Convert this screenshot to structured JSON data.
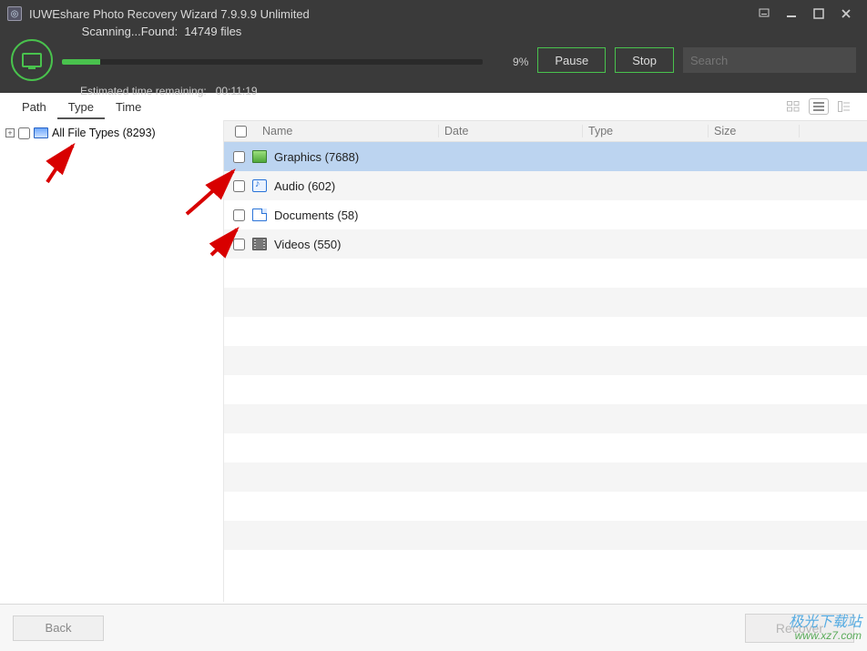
{
  "title_bar": {
    "app_title": "IUWEshare Photo Recovery Wizard 7.9.9.9 Unlimited"
  },
  "progress": {
    "line1_prefix": "Scanning...Found:  ",
    "found_count": "14749",
    "line1_suffix": " files",
    "percent_text": "9%",
    "percent_value": 9,
    "line2_prefix": "Estimated time remaining:   ",
    "eta": "00:11:19",
    "pause_label": "Pause",
    "stop_label": "Stop",
    "search_placeholder": "Search"
  },
  "tabs": {
    "path": "Path",
    "type": "Type",
    "time": "Time"
  },
  "tree": {
    "root_label": "All File Types (8293)"
  },
  "columns": {
    "name": "Name",
    "date": "Date",
    "type": "Type",
    "size": "Size"
  },
  "rows": [
    {
      "icon": "graphics",
      "label": "Graphics (7688)",
      "selected": true
    },
    {
      "icon": "audio",
      "label": "Audio (602)",
      "selected": false
    },
    {
      "icon": "doc",
      "label": "Documents (58)",
      "selected": false
    },
    {
      "icon": "video",
      "label": "Videos (550)",
      "selected": false
    }
  ],
  "footer": {
    "back": "Back",
    "recover": "Recover"
  },
  "watermark": {
    "line1": "极光下载站",
    "line2": "www.xz7.com"
  }
}
